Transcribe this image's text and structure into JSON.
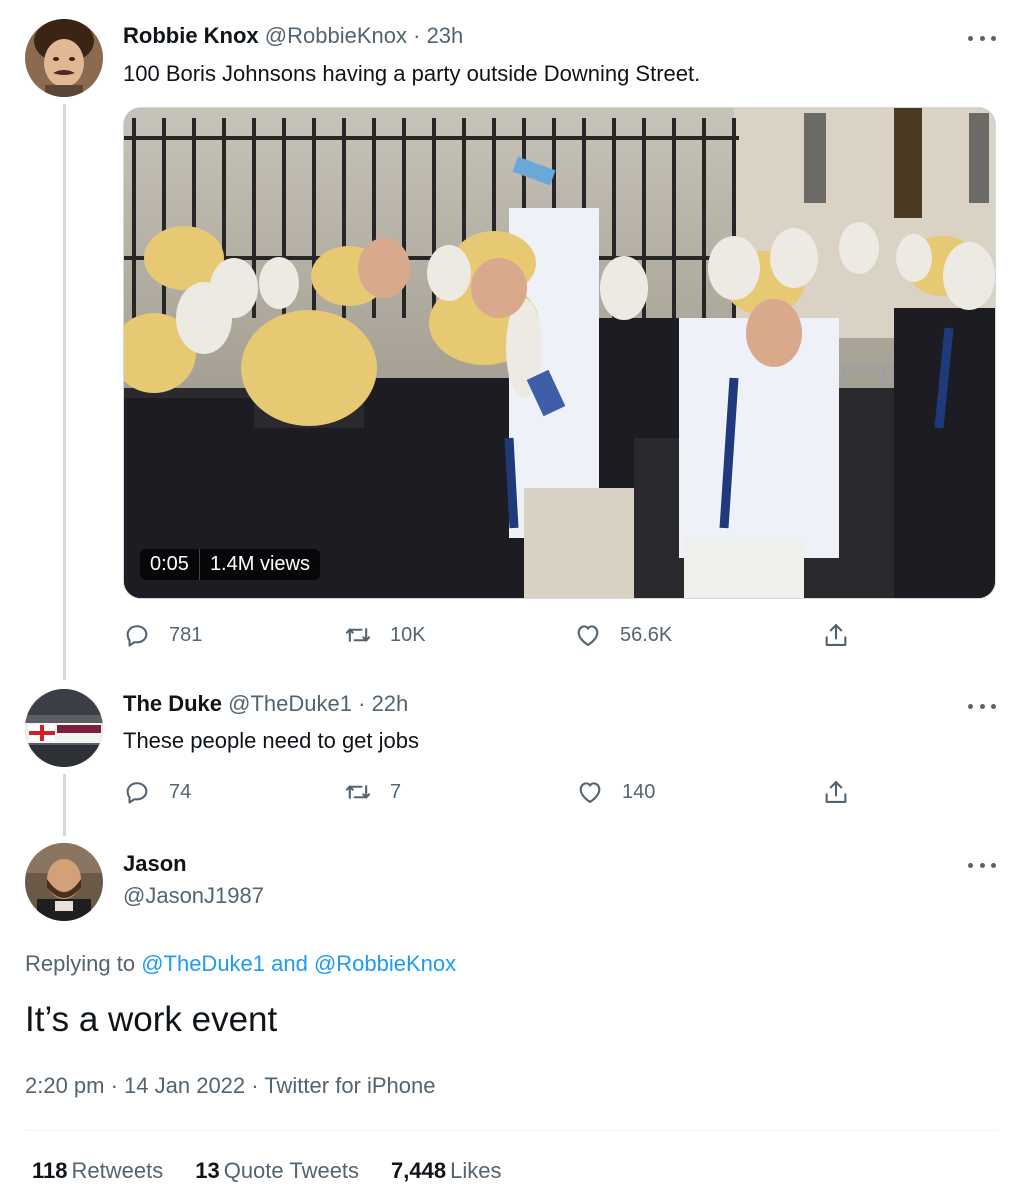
{
  "tweet1": {
    "name": "Robbie Knox",
    "handle": "@RobbieKnox",
    "time": "· 23h",
    "text": "100 Boris Johnsons having a party outside Downing Street.",
    "video": {
      "duration": "0:05",
      "views": "1.4M views"
    },
    "actions": {
      "replies": "781",
      "retweets": "10K",
      "likes": "56.6K"
    }
  },
  "tweet2": {
    "name": "The Duke",
    "handle": "@TheDuke1",
    "time": "· 22h",
    "text": "These people need to get jobs",
    "actions": {
      "replies": "74",
      "retweets": "7",
      "likes": "140"
    }
  },
  "tweet3": {
    "name": "Jason",
    "handle": "@JasonJ1987",
    "replying_prefix": "Replying to ",
    "replying_mentions": "@TheDuke1 and @RobbieKnox",
    "text": "It’s a work event",
    "meta": "2:20 pm · 14 Jan 2022 · Twitter for iPhone",
    "stats": {
      "retweets_count": "118",
      "retweets_label": "Retweets",
      "quotes_count": "13",
      "quotes_label": "Quote Tweets",
      "likes_count": "7,448",
      "likes_label": "Likes"
    }
  },
  "icons": {
    "reply": "reply-icon",
    "retweet": "retweet-icon",
    "like": "heart-icon",
    "share": "share-icon",
    "more": "more-icon"
  },
  "colors": {
    "link": "#1d9bf0",
    "secondary": "#536471",
    "text": "#0f1419",
    "line": "#cfd9de"
  }
}
